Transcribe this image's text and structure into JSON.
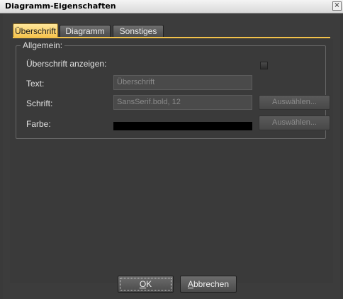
{
  "window": {
    "title": "Diagramm-Eigenschaften",
    "close_symbol": "×"
  },
  "tabs": [
    {
      "label": "Überschrift",
      "active": true
    },
    {
      "label": "Diagramm",
      "active": false
    },
    {
      "label": "Sonstiges",
      "active": false
    }
  ],
  "group": {
    "title": "Allgemein:",
    "show_heading_label": "Überschrift anzeigen:",
    "show_heading_checked": false,
    "text_label": "Text:",
    "text_value": "Überschrift",
    "font_label": "Schrift:",
    "font_value": "SansSerif.bold, 12",
    "font_choose_button": "Auswählen...",
    "color_label": "Farbe:",
    "color_value": "#000000",
    "color_choose_button": "Auswählen..."
  },
  "buttons": {
    "ok": "OK",
    "ok_mnemonic": "O",
    "ok_rest": "K",
    "cancel": "Abbrechen",
    "cancel_mnemonic": "A",
    "cancel_rest": "bbrechen"
  },
  "colors": {
    "active_tab": "#f6c24c",
    "background": "#3c3c3c",
    "text": "#e2e2e2"
  }
}
